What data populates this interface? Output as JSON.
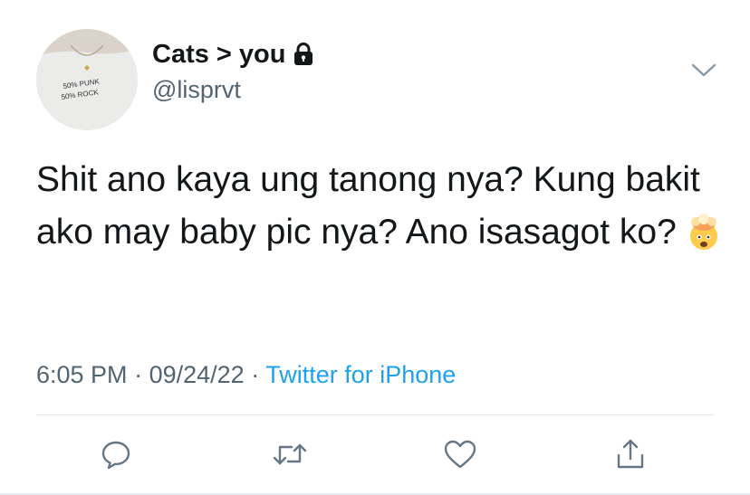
{
  "user": {
    "display_name": "Cats > you",
    "handle": "@lisprvt",
    "avatar_shirt_text": [
      "50% PUNK",
      "50% ROCK"
    ],
    "protected_icon": "lock-icon"
  },
  "tweet": {
    "text": "Shit ano kaya ung tanong nya? Kung bakit ako may baby pic nya? Ano isasagot ko?",
    "emoji": "exploding-head-emoji"
  },
  "meta": {
    "time": "6:05 PM",
    "date": "09/24/22",
    "separator": "·",
    "source": "Twitter for iPhone"
  },
  "actions": [
    {
      "name": "reply",
      "icon": "reply-icon"
    },
    {
      "name": "retweet",
      "icon": "retweet-icon"
    },
    {
      "name": "like",
      "icon": "heart-icon"
    },
    {
      "name": "share",
      "icon": "share-icon"
    }
  ],
  "colors": {
    "text": "#14171a",
    "secondary": "#536471",
    "link": "#1da1f2",
    "icon": "#657786",
    "divider": "#e1e8ed"
  }
}
